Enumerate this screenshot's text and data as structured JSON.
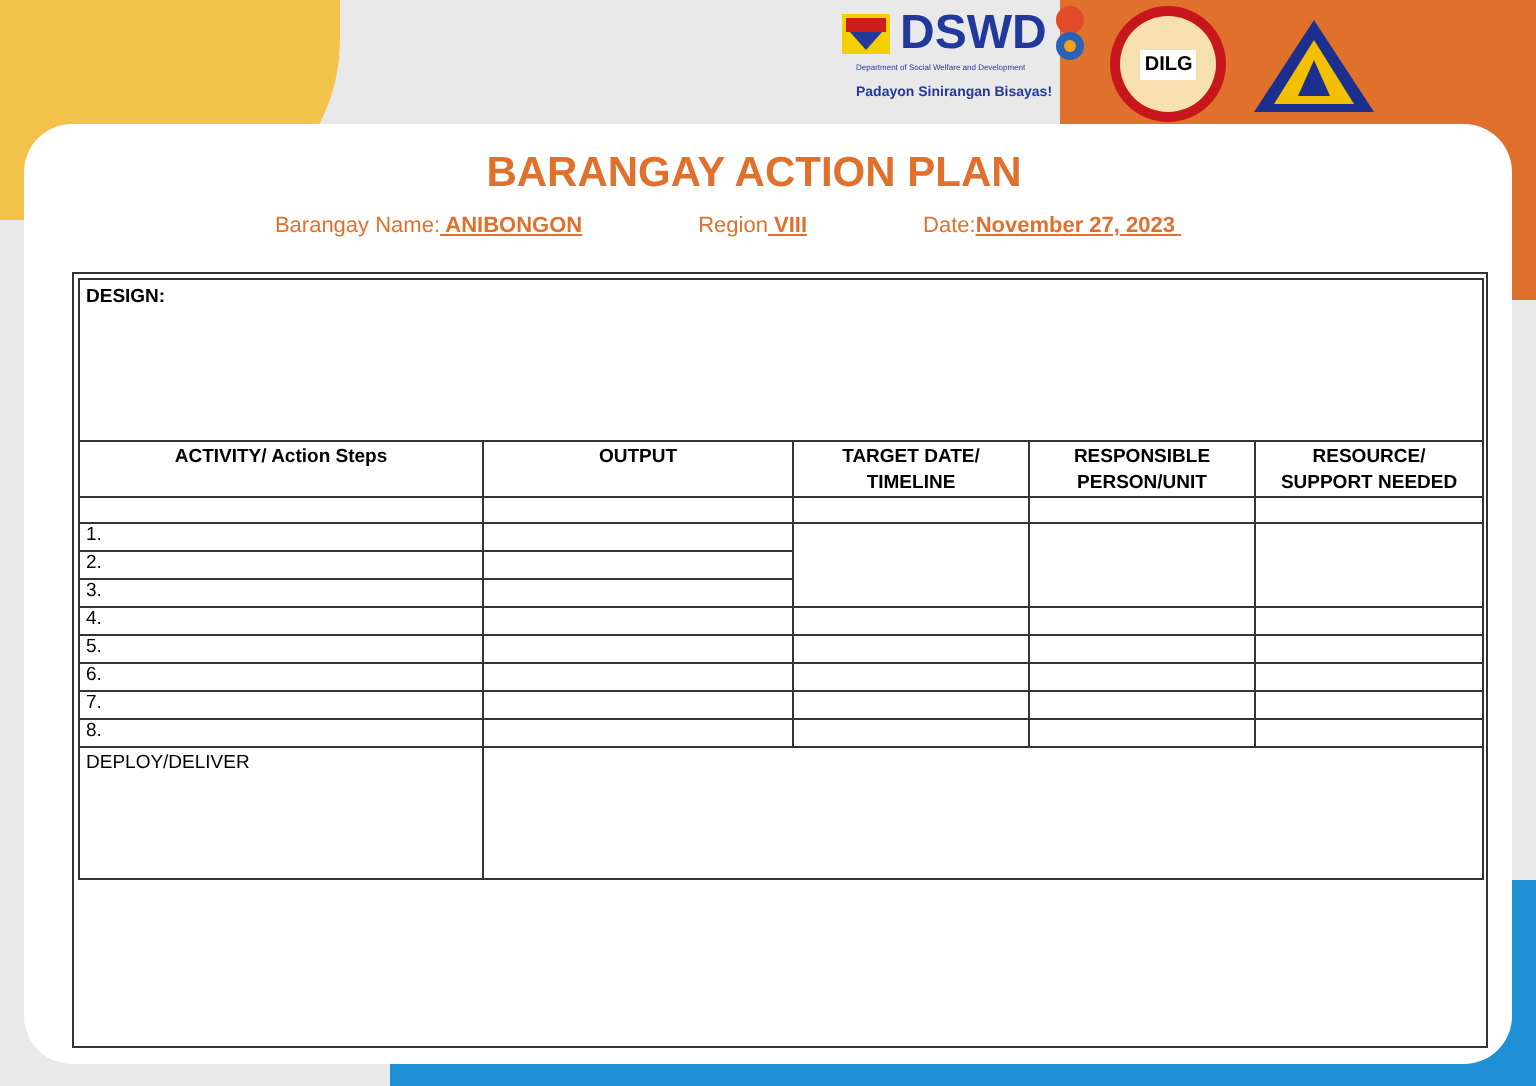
{
  "header": {
    "dswd": {
      "name": "DSWD",
      "subtitle": "Department of Social Welfare and Development",
      "slogan": "Padayon Sinirangan Bisayas!"
    },
    "dilg": {
      "name": "DILG"
    }
  },
  "title": "BARANGAY ACTION PLAN",
  "fields": [
    {
      "label": "Barangay Name:",
      "value": " ANIBONGON"
    },
    {
      "label": "Region",
      "value": " VIII"
    },
    {
      "label": "Date:",
      "value": "November 27, 2023 "
    }
  ],
  "table": {
    "design_label": "DESIGN:",
    "columns": [
      "ACTIVITY/ Action Steps",
      "OUTPUT",
      "TARGET DATE/ TIMELINE",
      "RESPONSIBLE PERSON/UNIT",
      "RESOURCE/ SUPPORT NEEDED"
    ],
    "steps": [
      "1.",
      "2.",
      "3.",
      "4.",
      "5.",
      "6.",
      "7.",
      "8."
    ],
    "deploy_label": "DEPLOY/DELIVER"
  }
}
